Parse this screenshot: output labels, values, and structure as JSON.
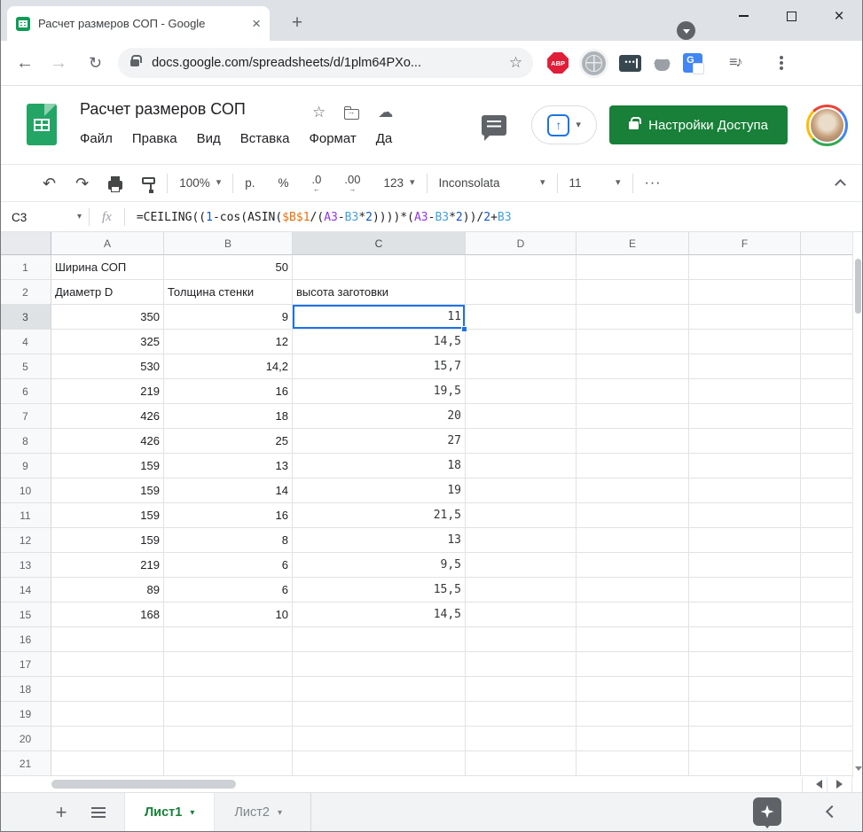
{
  "browser": {
    "tab_title": "Расчет размеров СОП - Google",
    "url": "docs.google.com/spreadsheets/d/1plm64PXo...",
    "extensions": [
      {
        "icon": "adblock-plus",
        "label": "ABP"
      },
      {
        "icon": "globe",
        "label": ""
      },
      {
        "icon": "password-vault",
        "label": "•••"
      },
      {
        "icon": "cat",
        "label": ""
      },
      {
        "icon": "google-translate",
        "label": "G"
      },
      {
        "icon": "extensions-puzzle",
        "label": ""
      },
      {
        "icon": "media-playlist",
        "label": "≡♪"
      },
      {
        "icon": "profile-avatar",
        "label": ""
      }
    ]
  },
  "sheets_header": {
    "doc_title": "Расчет размеров СОП",
    "menu": [
      "Файл",
      "Правка",
      "Вид",
      "Вставка",
      "Формат",
      "Да"
    ],
    "share_label": "Настройки Доступа"
  },
  "toolbar": {
    "zoom_level": "100%",
    "currency": "р.",
    "percent": "%",
    "dec_dec": ".0",
    "dec_inc": ".00",
    "more_formats": "123",
    "font_name": "Inconsolata",
    "font_size": "11",
    "more": "···"
  },
  "formula_bar": {
    "cell_ref": "C3",
    "fx_label": "fx",
    "tokens": [
      {
        "text": "=CEILING((",
        "color": "#202124"
      },
      {
        "text": "1",
        "color": "#1155CC"
      },
      {
        "text": "-cos(ASIN(",
        "color": "#202124"
      },
      {
        "text": "$B$1",
        "color": "#E8710A"
      },
      {
        "text": "/(",
        "color": "#202124"
      },
      {
        "text": "A3",
        "color": "#9334E6"
      },
      {
        "text": "-",
        "color": "#202124"
      },
      {
        "text": "B3",
        "color": "#43A0D9"
      },
      {
        "text": "*",
        "color": "#202124"
      },
      {
        "text": "2",
        "color": "#1155CC"
      },
      {
        "text": "))))*(",
        "color": "#202124"
      },
      {
        "text": "A3",
        "color": "#9334E6"
      },
      {
        "text": "-",
        "color": "#202124"
      },
      {
        "text": "B3",
        "color": "#43A0D9"
      },
      {
        "text": "*",
        "color": "#202124"
      },
      {
        "text": "2",
        "color": "#1155CC"
      },
      {
        "text": "))/",
        "color": "#202124"
      },
      {
        "text": "2",
        "color": "#1155CC"
      },
      {
        "text": "+",
        "color": "#202124"
      },
      {
        "text": "B3",
        "color": "#43A0D9"
      }
    ]
  },
  "grid": {
    "col_headers": [
      "A",
      "B",
      "C",
      "D",
      "E",
      "F",
      ""
    ],
    "selected_col": "C",
    "selected_row": "3",
    "rows": [
      {
        "n": "1",
        "A": "Ширина СОП",
        "B": "50",
        "C": ""
      },
      {
        "n": "2",
        "A": "Диаметр D",
        "B": "Толщина стенки",
        "C": "высота заготовки"
      },
      {
        "n": "3",
        "A": "350",
        "B": "9",
        "C": "11"
      },
      {
        "n": "4",
        "A": "325",
        "B": "12",
        "C": "14,5"
      },
      {
        "n": "5",
        "A": "530",
        "B": "14,2",
        "C": "15,7"
      },
      {
        "n": "6",
        "A": "219",
        "B": "16",
        "C": "19,5"
      },
      {
        "n": "7",
        "A": "426",
        "B": "18",
        "C": "20"
      },
      {
        "n": "8",
        "A": "426",
        "B": "25",
        "C": "27"
      },
      {
        "n": "9",
        "A": "159",
        "B": "13",
        "C": "18"
      },
      {
        "n": "10",
        "A": "159",
        "B": "14",
        "C": "19"
      },
      {
        "n": "11",
        "A": "159",
        "B": "16",
        "C": "21,5"
      },
      {
        "n": "12",
        "A": "159",
        "B": "8",
        "C": "13"
      },
      {
        "n": "13",
        "A": "219",
        "B": "6",
        "C": "9,5"
      },
      {
        "n": "14",
        "A": "89",
        "B": "6",
        "C": "15,5"
      },
      {
        "n": "15",
        "A": "168",
        "B": "10",
        "C": "14,5"
      },
      {
        "n": "16"
      },
      {
        "n": "17"
      },
      {
        "n": "18"
      },
      {
        "n": "19"
      },
      {
        "n": "20"
      },
      {
        "n": "21"
      }
    ]
  },
  "sheet_bar": {
    "tabs": [
      {
        "label": "Лист1",
        "active": true
      },
      {
        "label": "Лист2",
        "active": false
      }
    ]
  },
  "colors": {
    "selection_blue": "#1A73E8",
    "sheets_green": "#23A566",
    "share_button_green": "#188038",
    "active_sheet_tab_green": "#188038"
  }
}
